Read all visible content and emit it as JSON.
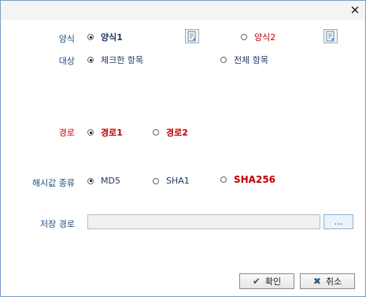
{
  "window": {
    "close_glyph": "✕"
  },
  "form": {
    "format": {
      "label": "양식",
      "option1": "양식1",
      "option2": "양식2",
      "selected": "option1",
      "doc_icon": "document-settings-icon"
    },
    "target": {
      "label": "대상",
      "option1": "체크한 항목",
      "option2": "전체 항목",
      "selected": "option1"
    },
    "path_choice": {
      "label": "경로",
      "option1": "경로1",
      "option2": "경로2",
      "selected": "option1"
    },
    "hash_type": {
      "label": "해시값 종류",
      "option1": "MD5",
      "option2": "SHA1",
      "option3": "SHA256",
      "selected": "option1"
    },
    "save_path": {
      "label": "저장 경로",
      "value": "",
      "browse_label": "..."
    }
  },
  "buttons": {
    "ok": {
      "label": "확인",
      "icon": "check-icon"
    },
    "cancel": {
      "label": "취소",
      "icon": "x-icon"
    }
  },
  "colors": {
    "label_blue": "#1f4e79",
    "label_red": "#c00000",
    "border": "#7a9cc6"
  }
}
